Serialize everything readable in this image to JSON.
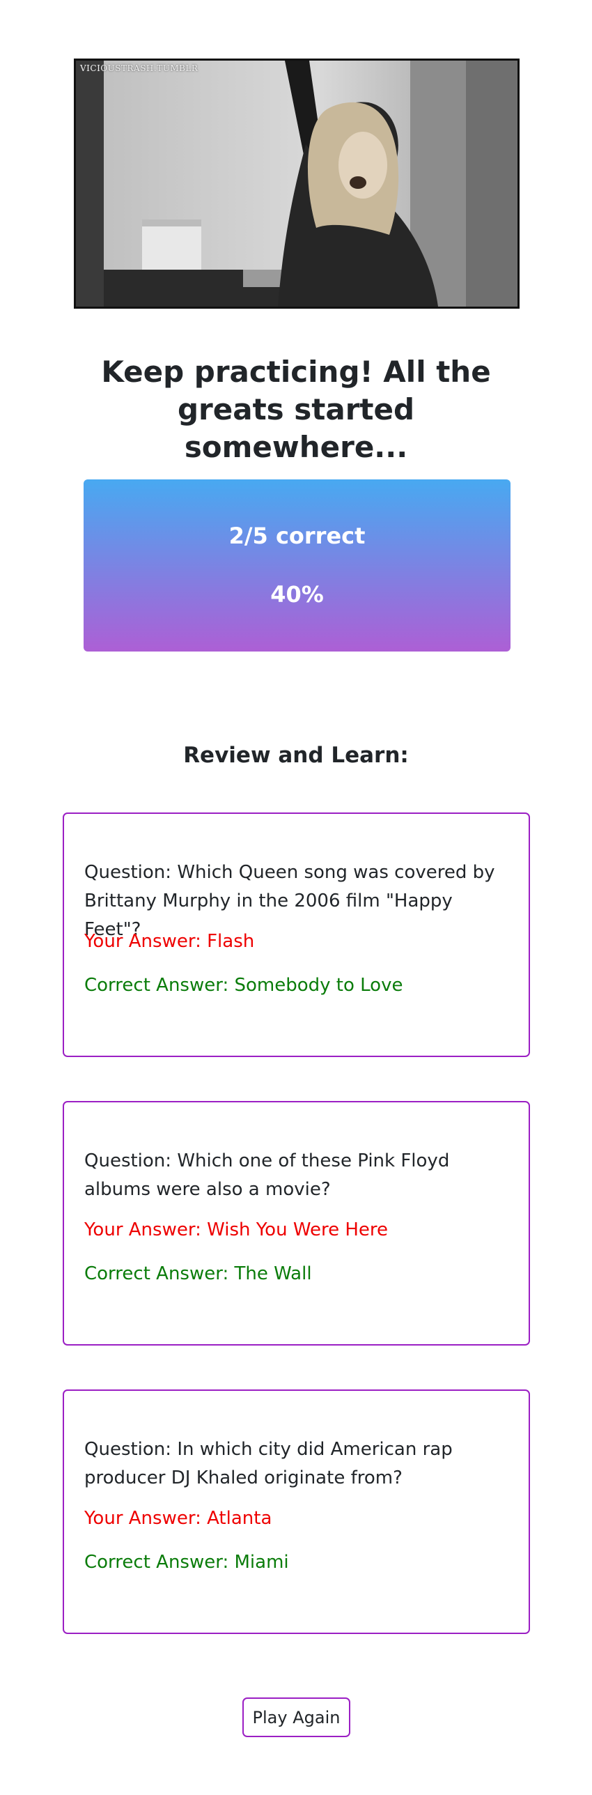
{
  "hero": {
    "watermark": "VICIOUSTRASH.TUMBLR",
    "icon": "photo-image"
  },
  "result": {
    "message": "Keep practicing! All the greats started somewhere...",
    "score_count": "2/5 correct",
    "score_percent": "40%"
  },
  "review": {
    "heading": "Review and Learn:",
    "items": [
      {
        "question": "Question: Which Queen song was covered by Brittany Murphy in the 2006 film \"Happy Feet\"?",
        "your_answer": "Your Answer: Flash",
        "correct_answer": "Correct Answer: Somebody to Love"
      },
      {
        "question": "Question: Which one of these Pink Floyd albums were also a movie?",
        "your_answer": "Your Answer: Wish You Were Here",
        "correct_answer": "Correct Answer: The Wall"
      },
      {
        "question": "Question: In which city did American rap producer DJ Khaled originate from?",
        "your_answer": "Your Answer: Atlanta",
        "correct_answer": "Correct Answer: Miami"
      }
    ]
  },
  "actions": {
    "play_again_label": "Play Again"
  },
  "colors": {
    "gradient_top": "#48a9f1",
    "gradient_bottom": "#ad5fd5",
    "card_border": "#9b1fc4",
    "wrong_answer": "#ee0000",
    "correct_answer": "#0a7c0a"
  }
}
